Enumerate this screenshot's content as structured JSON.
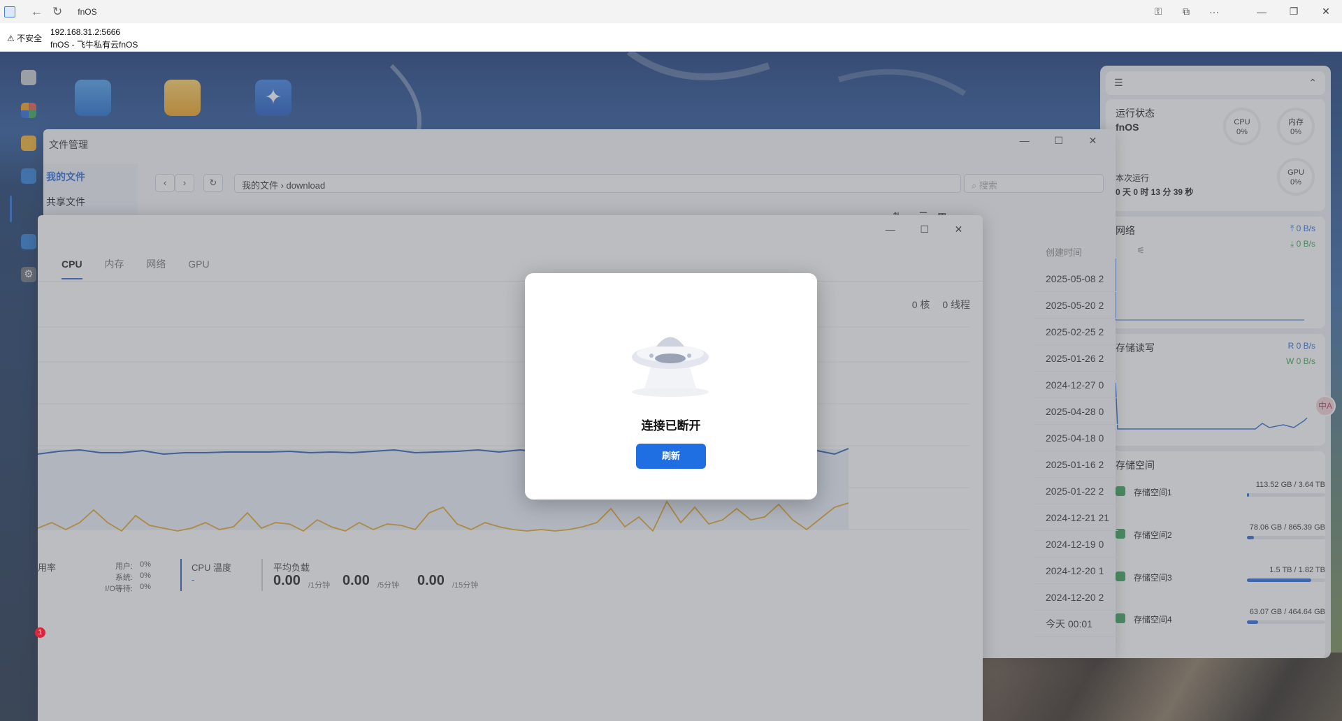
{
  "browser": {
    "tab_title": "fnOS",
    "security_label": "不安全",
    "url": "192.168.31.2:5666",
    "page_title": "fnOS - 飞牛私有云fnOS"
  },
  "file_manager": {
    "title": "文件管理",
    "sidebar": [
      "我的文件",
      "共享文件"
    ],
    "breadcrumb": "我的文件 › download",
    "search_placeholder": "搜索",
    "column_header": "创建时间",
    "created_times": [
      "2025-05-08 2",
      "2025-05-20 2",
      "2025-02-25 2",
      "2025-01-26 2",
      "2024-12-27 0",
      "2025-04-28 0",
      "2025-04-18 0",
      "2025-01-16 2",
      "2025-01-22 2",
      "2024-12-21 21",
      "2024-12-19 0",
      "2024-12-20 1",
      "2024-12-20 2",
      "今天 00:01"
    ]
  },
  "resource_monitor": {
    "tabs": [
      "CPU",
      "内存",
      "网络",
      "GPU"
    ],
    "active_tab": 0,
    "cores": "0 核",
    "threads": "0 线程",
    "usage_label": "用率",
    "user_label": "用户:",
    "user_value": "0%",
    "system_label": "系统:",
    "system_value": "0%",
    "io_label": "I/O等待:",
    "io_value": "0%",
    "temp_label": "CPU 温度",
    "temp_value": "-",
    "load_label": "平均负载",
    "load_1": "0.00",
    "load_1_unit": "/1分钟",
    "load_5": "0.00",
    "load_5_unit": "/5分钟",
    "load_15": "0.00",
    "load_15_unit": "/15分钟"
  },
  "widgets": {
    "status_title": "运行状态",
    "device_name": "fnOS",
    "cpu_label": "CPU",
    "cpu_value": "0%",
    "mem_label": "内存",
    "mem_value": "0%",
    "gpu_label": "GPU",
    "gpu_value": "0%",
    "uptime_label": "本次运行",
    "uptime_value": "0 天 0 时 13 分 39 秒",
    "network_title": "网络",
    "net_up": "0 B/s",
    "net_down": "0 B/s",
    "disk_title": "存储读写",
    "disk_read": "R  0 B/s",
    "disk_write": "W  0 B/s",
    "storage_title": "存储空间",
    "volumes": [
      {
        "name": "存储空间1",
        "size": "113.52 GB / 3.64 TB",
        "used": 0.03
      },
      {
        "name": "存储空间2",
        "size": "78.06 GB / 865.39 GB",
        "used": 0.09
      },
      {
        "name": "存储空间3",
        "size": "1.5 TB / 1.82 TB",
        "used": 0.82
      },
      {
        "name": "存储空间4",
        "size": "63.07 GB / 464.64 GB",
        "used": 0.14
      }
    ]
  },
  "notification_count": "1",
  "modal": {
    "message": "连接已断开",
    "button": "刷新"
  },
  "colors": {
    "accent": "#1f6fe3",
    "cpu_line": "#2c5fb8",
    "secondary_line": "#e3a82b",
    "net_up": "#2c6cd9",
    "net_down": "#3aa55c"
  }
}
